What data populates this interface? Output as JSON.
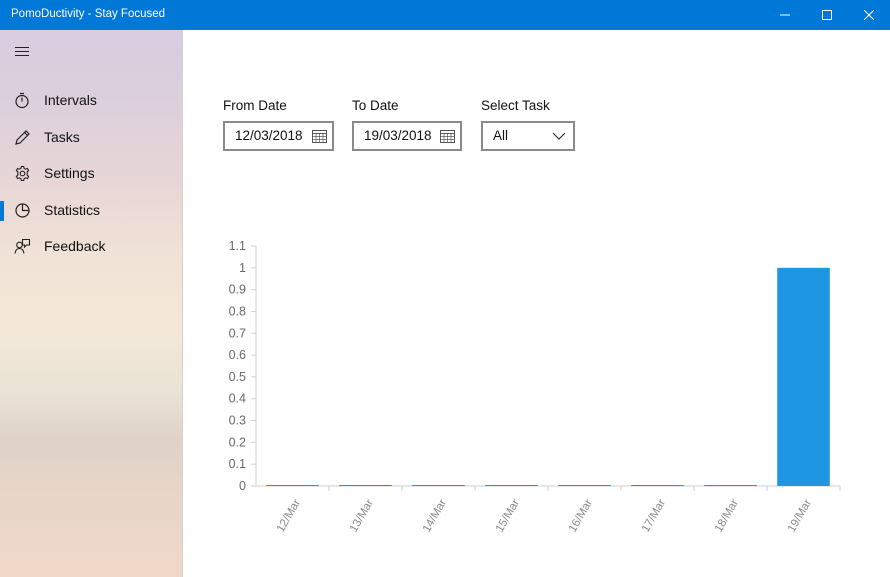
{
  "window": {
    "title": "PomoDuctivity - Stay Focused",
    "accent": "#0078d7"
  },
  "sidebar": {
    "items": [
      {
        "label": "Intervals",
        "icon": "stopwatch-icon",
        "selected": false
      },
      {
        "label": "Tasks",
        "icon": "pencil-icon",
        "selected": false
      },
      {
        "label": "Settings",
        "icon": "gear-icon",
        "selected": false
      },
      {
        "label": "Statistics",
        "icon": "pie-chart-icon",
        "selected": true
      },
      {
        "label": "Feedback",
        "icon": "feedback-person-icon",
        "selected": false
      }
    ]
  },
  "filters": {
    "from_label": "From Date",
    "from_value": "12/03/2018",
    "to_label": "To Date",
    "to_value": "19/03/2018",
    "task_label": "Select Task",
    "task_value": "All"
  },
  "chart_data": {
    "type": "bar",
    "categories": [
      "12/Mar",
      "13/Mar",
      "14/Mar",
      "15/Mar",
      "16/Mar",
      "17/Mar",
      "18/Mar",
      "19/Mar"
    ],
    "values": [
      0,
      0,
      0,
      0,
      0,
      0,
      0,
      1
    ],
    "y_ticks": [
      "0",
      "0.1",
      "0.2",
      "0.3",
      "0.4",
      "0.5",
      "0.6",
      "0.7",
      "0.8",
      "0.9",
      "1",
      "1.1"
    ],
    "ylim": [
      0,
      1.1
    ],
    "title": "",
    "xlabel": "",
    "ylabel": "",
    "grid": false,
    "bar_color": "#1e96e2"
  }
}
